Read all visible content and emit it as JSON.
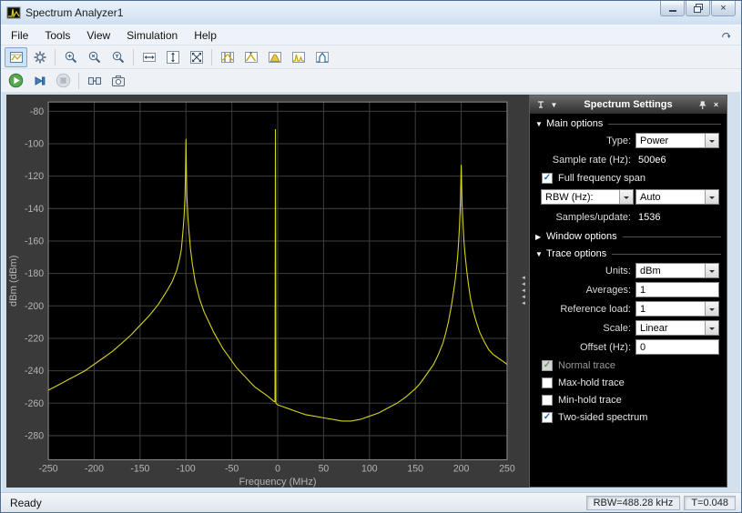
{
  "glyphs": {
    "check": "✓",
    "close": "×",
    "expanded": "▼",
    "collapsed": "▶",
    "splitter_arrow": "◄"
  },
  "window": {
    "title": "Spectrum Analyzer1"
  },
  "menu": {
    "items": [
      "File",
      "Tools",
      "View",
      "Simulation",
      "Help"
    ]
  },
  "toolbar_main": {
    "buttons": [
      "spectrum-settings-toggle",
      "configuration-properties",
      "zoom-in",
      "zoom-x",
      "zoom-y",
      "scale-x-axis",
      "scale-y-axis",
      "fit-to-view",
      "cursor-measurements",
      "peak-finder",
      "channel-measurements",
      "distortion-measurements",
      "spectral-mask"
    ]
  },
  "toolbar_sim": {
    "buttons": [
      "run",
      "step-forward",
      "stop",
      "simulink-source",
      "snapshot"
    ]
  },
  "settings": {
    "header_title": "Spectrum Settings",
    "sections": {
      "main": {
        "title": "Main options",
        "expanded": true,
        "rows": {
          "type": {
            "label": "Type:",
            "value": "Power"
          },
          "sample_rate": {
            "label": "Sample rate (Hz):",
            "value": "500e6"
          },
          "full_span": {
            "label": "Full frequency span",
            "checked": true
          },
          "rbw": {
            "label": "RBW (Hz):",
            "value": "Auto"
          },
          "samples": {
            "label": "Samples/update:",
            "value": "1536"
          }
        }
      },
      "window": {
        "title": "Window options",
        "expanded": false
      },
      "trace": {
        "title": "Trace options",
        "expanded": true,
        "rows": {
          "units": {
            "label": "Units:",
            "value": "dBm"
          },
          "averages": {
            "label": "Averages:",
            "value": "1"
          },
          "reference_load": {
            "label": "Reference load:",
            "value": "1"
          },
          "scale": {
            "label": "Scale:",
            "value": "Linear"
          },
          "offset": {
            "label": "Offset (Hz):",
            "value": "0"
          },
          "normal": {
            "label": "Normal trace",
            "checked": true,
            "disabled": true
          },
          "max_hold": {
            "label": "Max-hold trace",
            "checked": false
          },
          "min_hold": {
            "label": "Min-hold trace",
            "checked": false
          },
          "two_sided": {
            "label": "Two-sided spectrum",
            "checked": true
          }
        }
      }
    }
  },
  "statusbar": {
    "status": "Ready",
    "rbw": "RBW=488.28 kHz",
    "time": "T=0.048"
  },
  "chart_data": {
    "type": "line",
    "title": "",
    "xlabel": "Frequency (MHz)",
    "ylabel": "dBm (dBm)",
    "xlim": [
      -250,
      250
    ],
    "ylim": [
      -295,
      -74
    ],
    "xticks": [
      -250,
      -200,
      -150,
      -100,
      -50,
      0,
      50,
      100,
      150,
      200,
      250
    ],
    "yticks": [
      -80,
      -100,
      -120,
      -140,
      -160,
      -180,
      -200,
      -220,
      -240,
      -260,
      -280
    ],
    "grid": true,
    "background": "#000000",
    "plot_surround": "#3a3a3a",
    "grid_color": "#3e3e3e",
    "frame_color": "#8c8c8c",
    "tick_color": "#b4b4b4",
    "trace_color": "#d6d21e",
    "legend": null,
    "series": [
      {
        "name": "spectrum",
        "points": [
          [
            -250,
            -252
          ],
          [
            -240,
            -249
          ],
          [
            -230,
            -246
          ],
          [
            -220,
            -243
          ],
          [
            -210,
            -240
          ],
          [
            -200,
            -236
          ],
          [
            -190,
            -232
          ],
          [
            -180,
            -228
          ],
          [
            -170,
            -223
          ],
          [
            -160,
            -218
          ],
          [
            -150,
            -212
          ],
          [
            -140,
            -206
          ],
          [
            -130,
            -199
          ],
          [
            -120,
            -190
          ],
          [
            -115,
            -185
          ],
          [
            -110,
            -178
          ],
          [
            -107,
            -171
          ],
          [
            -105,
            -165
          ],
          [
            -103,
            -152
          ],
          [
            -102,
            -144
          ],
          [
            -101,
            -132
          ],
          [
            -100.5,
            -118
          ],
          [
            -100,
            -97
          ],
          [
            -99.5,
            -118
          ],
          [
            -99,
            -132
          ],
          [
            -98,
            -144
          ],
          [
            -97,
            -152
          ],
          [
            -95,
            -165
          ],
          [
            -93,
            -174
          ],
          [
            -90,
            -185
          ],
          [
            -85,
            -196
          ],
          [
            -80,
            -204
          ],
          [
            -75,
            -210
          ],
          [
            -70,
            -216
          ],
          [
            -65,
            -221
          ],
          [
            -60,
            -226
          ],
          [
            -55,
            -230
          ],
          [
            -50,
            -234
          ],
          [
            -45,
            -238
          ],
          [
            -40,
            -241
          ],
          [
            -35,
            -244
          ],
          [
            -30,
            -247
          ],
          [
            -25,
            -250
          ],
          [
            -20,
            -252
          ],
          [
            -15,
            -254
          ],
          [
            -10,
            -256
          ],
          [
            -6,
            -258
          ],
          [
            -4,
            -259
          ],
          [
            -3,
            -259
          ],
          [
            -2.5,
            -91
          ],
          [
            -2,
            -260
          ],
          [
            0,
            -261
          ],
          [
            5,
            -262
          ],
          [
            10,
            -263
          ],
          [
            15,
            -264
          ],
          [
            20,
            -265
          ],
          [
            25,
            -266
          ],
          [
            30,
            -267
          ],
          [
            40,
            -268
          ],
          [
            50,
            -269
          ],
          [
            60,
            -270
          ],
          [
            70,
            -271
          ],
          [
            80,
            -271
          ],
          [
            90,
            -270
          ],
          [
            100,
            -268
          ],
          [
            110,
            -266
          ],
          [
            120,
            -263
          ],
          [
            130,
            -260
          ],
          [
            140,
            -256
          ],
          [
            150,
            -251
          ],
          [
            155,
            -248
          ],
          [
            160,
            -244
          ],
          [
            165,
            -240
          ],
          [
            170,
            -236
          ],
          [
            175,
            -230
          ],
          [
            180,
            -223
          ],
          [
            183,
            -217
          ],
          [
            186,
            -210
          ],
          [
            189,
            -201
          ],
          [
            191,
            -194
          ],
          [
            193,
            -186
          ],
          [
            195,
            -176
          ],
          [
            196,
            -170
          ],
          [
            197,
            -162
          ],
          [
            198,
            -152
          ],
          [
            199,
            -138
          ],
          [
            199.5,
            -126
          ],
          [
            200,
            -113
          ],
          [
            200.5,
            -126
          ],
          [
            201,
            -138
          ],
          [
            202,
            -150
          ],
          [
            203,
            -160
          ],
          [
            204,
            -167
          ],
          [
            206,
            -178
          ],
          [
            208,
            -187
          ],
          [
            210,
            -195
          ],
          [
            213,
            -203
          ],
          [
            216,
            -209
          ],
          [
            220,
            -216
          ],
          [
            225,
            -222
          ],
          [
            230,
            -227
          ],
          [
            235,
            -230
          ],
          [
            240,
            -232
          ],
          [
            245,
            -234
          ],
          [
            250,
            -236
          ]
        ]
      }
    ]
  }
}
